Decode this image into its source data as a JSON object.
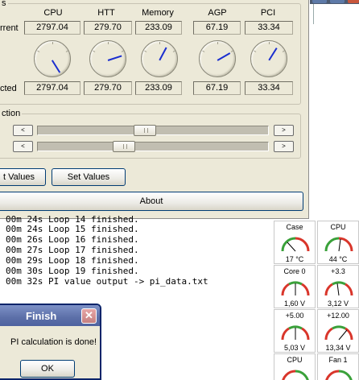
{
  "clock": {
    "group_title_partial": "s",
    "columns": [
      "CPU",
      "HTT",
      "Memory",
      "AGP",
      "PCI"
    ],
    "row_current_label": "rrent",
    "row_expected_label": "cted",
    "current": [
      "2797.04",
      "279.70",
      "233.09",
      "67.19",
      "33.34"
    ],
    "expected": [
      "2797.04",
      "279.70",
      "233.09",
      "67.19",
      "33.34"
    ],
    "selection_title_partial": "ction",
    "slider1_level": 0.46,
    "slider2_level": 0.36,
    "arrow_left": "<",
    "arrow_right": ">",
    "get_values_label": "t Values",
    "set_values_label": "Set Values",
    "about_label": "About"
  },
  "console": {
    "lines": [
      "00m 24s Loop 14 finished.",
      "00m 24s Loop 15 finished.",
      "00m 26s Loop 16 finished.",
      "00m 27s Loop 17 finished.",
      "00m 29s Loop 18 finished.",
      "00m 30s Loop 19 finished.",
      "00m 32s PI value output -> pi_data.txt"
    ]
  },
  "sensors": [
    {
      "label": "Case",
      "value": "17 °C"
    },
    {
      "label": "CPU",
      "value": "44 °C"
    },
    {
      "label": "Core 0",
      "value": "1,60 V"
    },
    {
      "label": "+3.3",
      "value": "3,12 V"
    },
    {
      "label": "+5.00",
      "value": "5,03 V"
    },
    {
      "label": "+12.00",
      "value": "13,34 V"
    },
    {
      "label": "CPU",
      "value": ""
    },
    {
      "label": "Fan 1",
      "value": ""
    }
  ],
  "finish_dialog": {
    "title": "Finish",
    "message": "PI calculation is done!",
    "ok_label": "OK",
    "close_glyph": "✕"
  },
  "colors": {
    "window_bg": "#ece9d8",
    "needle": "#1a2ecf",
    "gauge_red": "#d9362b",
    "gauge_green": "#3aa13a",
    "title_bar": "#5c6fa8"
  }
}
